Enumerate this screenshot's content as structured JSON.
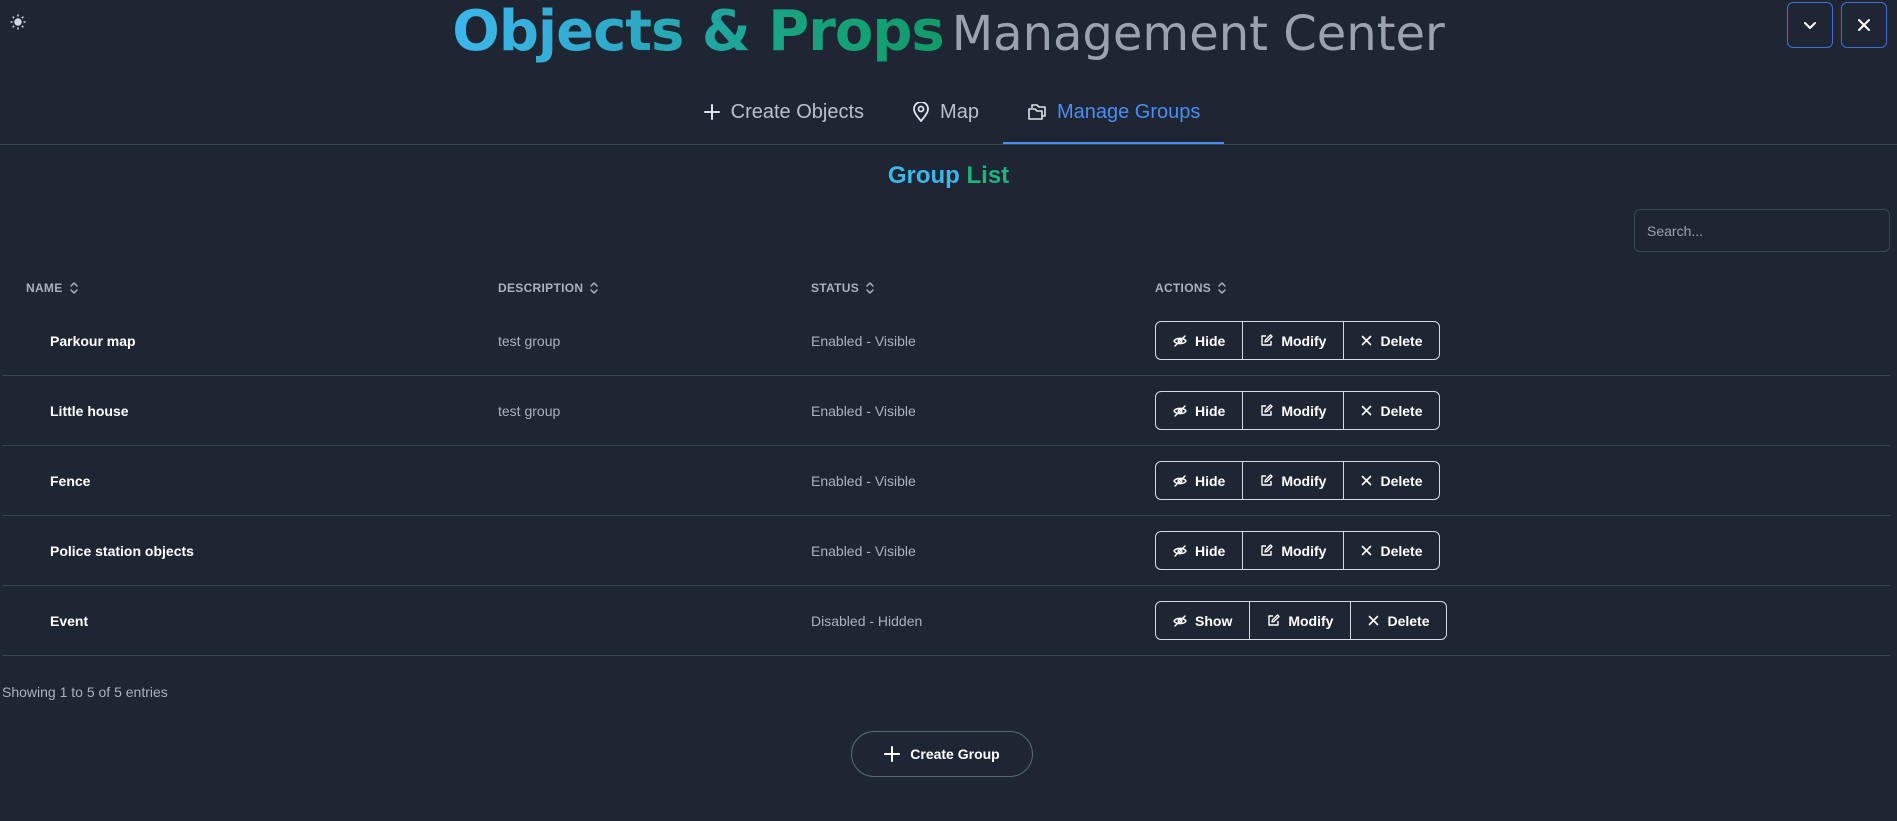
{
  "header": {
    "title_main": "Objects & Props",
    "title_sub": "Management Center"
  },
  "tabs": [
    {
      "label": "Create Objects",
      "icon": "plus-icon"
    },
    {
      "label": "Map",
      "icon": "map-pin-icon"
    },
    {
      "label": "Manage Groups",
      "icon": "folders-icon",
      "active": true
    }
  ],
  "section": {
    "title_a": "Group",
    "title_b": "List"
  },
  "search": {
    "placeholder": "Search..."
  },
  "table": {
    "headers": {
      "name": "NAME",
      "description": "DESCRIPTION",
      "status": "STATUS",
      "actions": "ACTIONS"
    },
    "rows": [
      {
        "name": "Parkour map",
        "description": "test group",
        "status": "Enabled - Visible",
        "toggle_label": "Hide",
        "modify_label": "Modify",
        "delete_label": "Delete"
      },
      {
        "name": "Little house",
        "description": "test group",
        "status": "Enabled - Visible",
        "toggle_label": "Hide",
        "modify_label": "Modify",
        "delete_label": "Delete"
      },
      {
        "name": "Fence",
        "description": "",
        "status": "Enabled - Visible",
        "toggle_label": "Hide",
        "modify_label": "Modify",
        "delete_label": "Delete"
      },
      {
        "name": "Police station objects",
        "description": "",
        "status": "Enabled - Visible",
        "toggle_label": "Hide",
        "modify_label": "Modify",
        "delete_label": "Delete"
      },
      {
        "name": "Event",
        "description": "",
        "status": "Disabled - Hidden",
        "toggle_label": "Show",
        "modify_label": "Modify",
        "delete_label": "Delete"
      }
    ]
  },
  "footer": {
    "info": "Showing 1 to 5 of 5 entries",
    "create_label": "Create Group"
  },
  "colors": {
    "background": "#1f2633",
    "accent_blue": "#4d8cf3",
    "title_cyan": "#3db6ea",
    "title_green": "#1bb57e"
  }
}
